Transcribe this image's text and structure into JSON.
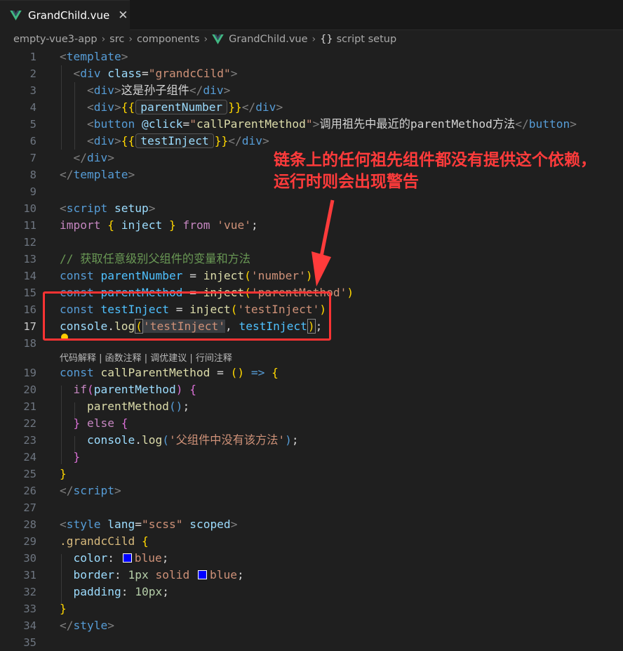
{
  "tab": {
    "filename": "GrandChild.vue",
    "close_glyph": "✕",
    "icon": "vue-logo-icon"
  },
  "breadcrumb": {
    "items": [
      "empty-vue3-app",
      "src",
      "components",
      "GrandChild.vue",
      "script setup"
    ],
    "separator": "›",
    "braces": "{}"
  },
  "current_line": 17,
  "codelens": "代码解释 | 函数注释 | 调优建议 | 行间注释",
  "annotation": {
    "text": "链条上的任何祖先组件都没有提供这个依赖，运行时则会出现警告",
    "color": "#ff3b3b"
  },
  "code": {
    "l2_class": "grandcCild",
    "l3_text": "这是孙子组件",
    "l4_var": "parentNumber",
    "l5_click": "callParentMethod",
    "l5_text": "调用祖先中最近的parentMethod方法",
    "l6_var": "testInject",
    "l11_from": "vue",
    "l13_comment": "// 获取任意级别父组件的变量和方法",
    "l14_key": "number",
    "l15_key": "parentMethod",
    "l16_key": "testInject",
    "l17_str": "testInject",
    "l23_str": "父组件中没有该方法",
    "l28_lang": "scss",
    "l29_sel": ".grandcCild",
    "color_value": "blue",
    "border_width": "1px",
    "padding_value": "10px"
  },
  "colors": {
    "background": "#1f1f1f",
    "swatch": "#0000ff"
  }
}
